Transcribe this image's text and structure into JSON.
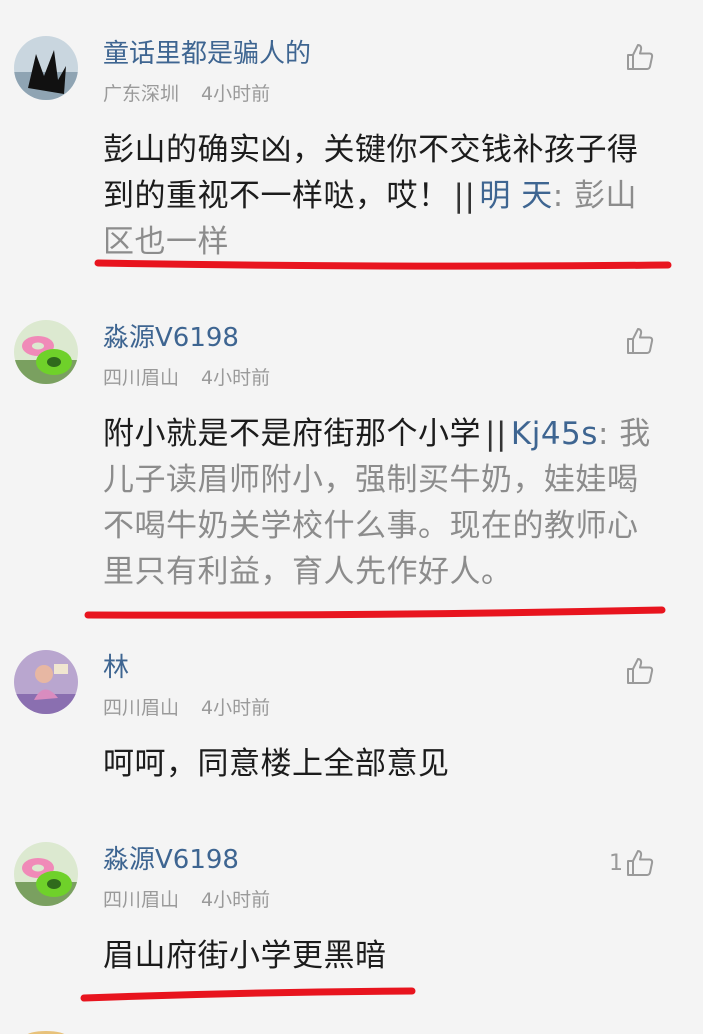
{
  "comments": [
    {
      "username": "童话里都是骗人的",
      "location": "广东深圳",
      "time": "4小时前",
      "likes": "",
      "text": "彭山的确实凶，关键你不交钱补孩子得到的重视不一样哒，哎！",
      "separator": "||",
      "reply_user": "明 天",
      "reply_text": ": 彭山区也一样"
    },
    {
      "username": "淼源V6198",
      "location": "四川眉山",
      "time": "4小时前",
      "likes": "",
      "text": "附小就是不是府街那个小学",
      "separator": "||",
      "reply_user": "Kj45s",
      "reply_text": ": 我儿子读眉师附小，强制买牛奶，娃娃喝不喝牛奶关学校什么事。现在的教师心里只有利益，育人先作好人。"
    },
    {
      "username": "林",
      "location": "四川眉山",
      "time": "4小时前",
      "likes": "",
      "text": "呵呵，同意楼上全部意见"
    },
    {
      "username": "淼源V6198",
      "location": "四川眉山",
      "time": "4小时前",
      "likes": "1",
      "text": "眉山府街小学更黑暗"
    }
  ],
  "icons": {
    "like": "thumbs-up-icon"
  },
  "colors": {
    "username": "#3e6591",
    "meta": "#9a9a9a",
    "reply_text": "#8c8c8c",
    "annotation_underline": "#e8141e",
    "background": "#f4f4f4"
  }
}
